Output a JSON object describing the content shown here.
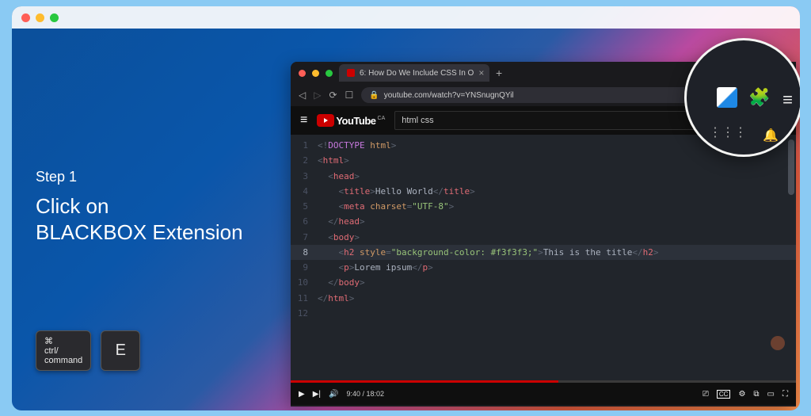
{
  "instructions": {
    "step_label": "Step 1",
    "step_text_l1": "Click on",
    "step_text_l2": "BLACKBOX Extension"
  },
  "shortcut": {
    "modifier_symbol": "⌘",
    "modifier_text": "ctrl/\ncommand",
    "key": "E"
  },
  "browser": {
    "tab_title": "6: How Do We Include CSS In O",
    "url": "youtube.com/watch?v=YNSnugnQYil"
  },
  "youtube": {
    "brand": "YouTube",
    "region": "CA",
    "search_value": "html css",
    "time_current": "9:40",
    "time_total": "18:02",
    "cc_label": "CC"
  },
  "code": {
    "l1": {
      "n": "1",
      "a": "<!",
      "b": "DOCTYPE",
      "c": " html",
      "d": ">"
    },
    "l2": {
      "n": "2",
      "a": "<",
      "b": "html",
      "c": ">"
    },
    "l3": {
      "n": "3",
      "pad": "  ",
      "a": "<",
      "b": "head",
      "c": ">"
    },
    "l4": {
      "n": "4",
      "pad": "    ",
      "a": "<",
      "b": "title",
      "c": ">",
      "t": "Hello World",
      "d": "</",
      "e": "title",
      "f": ">"
    },
    "l5": {
      "n": "5",
      "pad": "    ",
      "a": "<",
      "b": "meta",
      "sp": " ",
      "attr": "charset",
      "eq": "=",
      "val": "\"UTF-8\"",
      "c": ">"
    },
    "l6": {
      "n": "6",
      "pad": "  ",
      "a": "</",
      "b": "head",
      "c": ">"
    },
    "l7": {
      "n": "7",
      "pad": "  ",
      "a": "<",
      "b": "body",
      "c": ">"
    },
    "l8": {
      "n": "8",
      "pad": "    ",
      "a": "<",
      "b": "h2",
      "sp": " ",
      "attr": "style",
      "eq": "=",
      "val": "\"background-color: #f3f3f3;\"",
      "c": ">",
      "t": "This is the title",
      "d": "</",
      "e": "h2",
      "f": ">"
    },
    "l9": {
      "n": "9",
      "pad": "    ",
      "a": "<",
      "b": "p",
      "c": ">",
      "t": "Lorem ipsum",
      "d": "</",
      "e": "p",
      "f": ">"
    },
    "l10": {
      "n": "10",
      "pad": "  ",
      "a": "</",
      "b": "body",
      "c": ">"
    },
    "l11": {
      "n": "11",
      "a": "</",
      "b": "html",
      "c": ">"
    },
    "l12": {
      "n": "12"
    }
  },
  "icons": {
    "back": "◁",
    "fwd": "▷",
    "reload": "⟳",
    "bookmark": "☐",
    "lock": "🔒",
    "cast": "⎚",
    "star": "★",
    "ext": "⬚",
    "alert": "▲",
    "menu": "≡",
    "close": "×",
    "search": "🔍",
    "mic": "🎤",
    "play": "▶",
    "next": "▶|",
    "volume": "🔊",
    "cog": "⚙",
    "theater": "▭",
    "mini": "⧉",
    "full": "⛶",
    "sub": "⎚",
    "plus": "+",
    "puzzle": "🧩",
    "eq": "≡",
    "grid": "⋮⋮⋮",
    "bell": "🔔"
  }
}
